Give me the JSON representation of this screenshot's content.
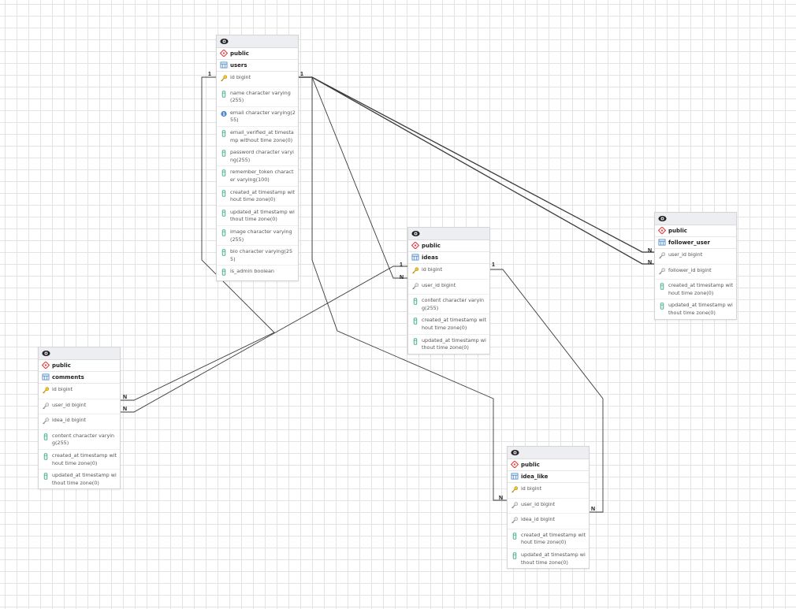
{
  "tables": {
    "users": {
      "schema": "public",
      "name": "users",
      "columns": [
        {
          "icon": "primary-key-icon",
          "text": "id bigint"
        },
        {
          "icon": "column-icon",
          "text": "name character varying(255)"
        },
        {
          "icon": "unique-icon",
          "text": "email character varying(255)"
        },
        {
          "icon": "column-icon",
          "text": "email_verified_at timestamp without time zone(0)"
        },
        {
          "icon": "column-icon",
          "text": "password character varying(255)"
        },
        {
          "icon": "column-icon",
          "text": "remember_token character varying(100)"
        },
        {
          "icon": "column-icon",
          "text": "created_at timestamp without time zone(0)"
        },
        {
          "icon": "column-icon",
          "text": "updated_at timestamp without time zone(0)"
        },
        {
          "icon": "column-icon",
          "text": "image character varying(255)"
        },
        {
          "icon": "column-icon",
          "text": "bio character varying(255)"
        },
        {
          "icon": "column-icon",
          "text": "is_admin boolean"
        }
      ]
    },
    "ideas": {
      "schema": "public",
      "name": "ideas",
      "columns": [
        {
          "icon": "primary-key-icon",
          "text": "id bigint"
        },
        {
          "icon": "foreign-key-icon",
          "text": "user_id bigint"
        },
        {
          "icon": "column-icon",
          "text": "content character varying(255)"
        },
        {
          "icon": "column-icon",
          "text": "created_at timestamp without time zone(0)"
        },
        {
          "icon": "column-icon",
          "text": "updated_at timestamp without time zone(0)"
        }
      ]
    },
    "follower_user": {
      "schema": "public",
      "name": "follower_user",
      "columns": [
        {
          "icon": "foreign-key-icon",
          "text": "user_id bigint"
        },
        {
          "icon": "foreign-key-icon",
          "text": "follower_id bigint"
        },
        {
          "icon": "column-icon",
          "text": "created_at timestamp without time zone(0)"
        },
        {
          "icon": "column-icon",
          "text": "updated_at timestamp without time zone(0)"
        }
      ]
    },
    "comments": {
      "schema": "public",
      "name": "comments",
      "columns": [
        {
          "icon": "primary-key-icon",
          "text": "id bigint"
        },
        {
          "icon": "foreign-key-icon",
          "text": "user_id bigint"
        },
        {
          "icon": "foreign-key-icon",
          "text": "idea_id bigint"
        },
        {
          "icon": "column-icon",
          "text": "content character varying(255)"
        },
        {
          "icon": "column-icon",
          "text": "created_at timestamp without time zone(0)"
        },
        {
          "icon": "column-icon",
          "text": "updated_at timestamp without time zone(0)"
        }
      ]
    },
    "idea_like": {
      "schema": "public",
      "name": "idea_like",
      "columns": [
        {
          "icon": "primary-key-icon",
          "text": "id bigint"
        },
        {
          "icon": "foreign-key-icon",
          "text": "user_id bigint"
        },
        {
          "icon": "foreign-key-icon",
          "text": "idea_id bigint"
        },
        {
          "icon": "column-icon",
          "text": "created_at timestamp without time zone(0)"
        },
        {
          "icon": "column-icon",
          "text": "updated_at timestamp without time zone(0)"
        }
      ]
    }
  },
  "relations": [
    {
      "from": "users.id",
      "to": "ideas.user_id",
      "from_card": "1",
      "to_card": "N"
    },
    {
      "from": "users.id",
      "to": "follower_user.user_id",
      "from_card": "1",
      "to_card": "N"
    },
    {
      "from": "users.id",
      "to": "follower_user.follower_id",
      "from_card": "1",
      "to_card": "N"
    },
    {
      "from": "users.id",
      "to": "comments.user_id",
      "from_card": "1",
      "to_card": "N"
    },
    {
      "from": "users.id",
      "to": "idea_like.user_id",
      "from_card": "1",
      "to_card": "N"
    },
    {
      "from": "ideas.id",
      "to": "comments.idea_id",
      "from_card": "1",
      "to_card": "N"
    },
    {
      "from": "ideas.id",
      "to": "idea_like.idea_id",
      "from_card": "1",
      "to_card": "N"
    }
  ],
  "colors": {
    "line": "#3a3a3a",
    "schema_icon": "#d94848",
    "table_icon": "#4a86c8",
    "column_icon": "#2fa37f",
    "key_icon": "#d9a520",
    "fk_icon": "#8a8a8a"
  }
}
